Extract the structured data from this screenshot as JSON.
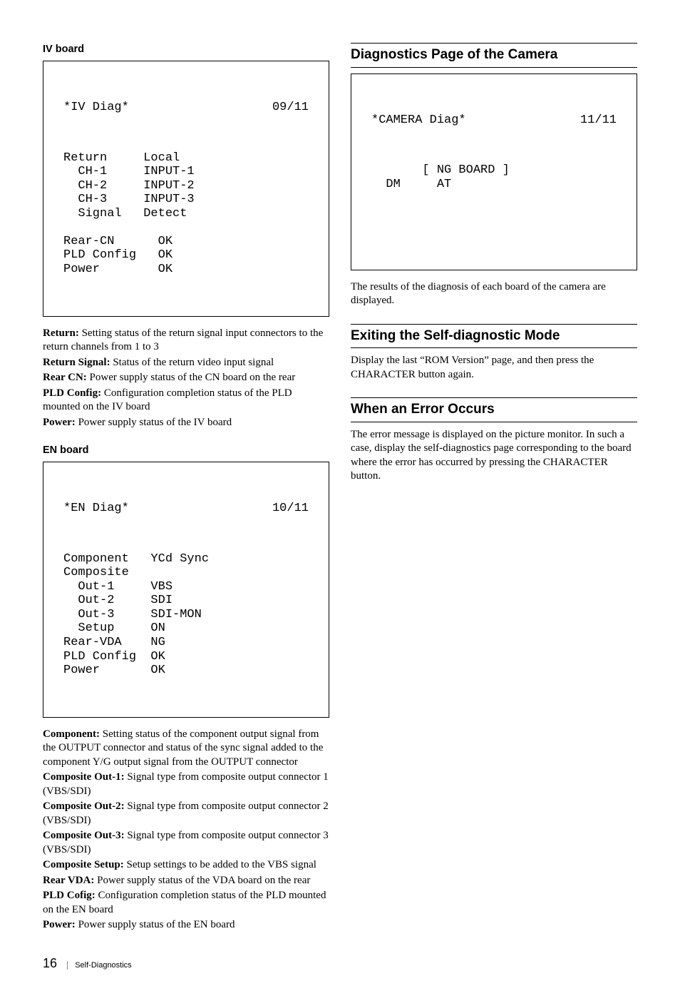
{
  "left": {
    "iv": {
      "heading": "IV board",
      "box": {
        "title": "*IV Diag*",
        "page": "09/11",
        "lines": [
          "Return     Local",
          "  CH-1     INPUT-1",
          "  CH-2     INPUT-2",
          "  CH-3     INPUT-3",
          "  Signal   Detect",
          "",
          "Rear-CN      OK",
          "PLD Config   OK",
          "Power        OK"
        ]
      },
      "defs": [
        {
          "t": "Return:",
          "d": " Setting status of the return signal input connectors to the return channels from 1 to 3"
        },
        {
          "t": "Return Signal:",
          "d": " Status of the return video input signal"
        },
        {
          "t": "Rear CN:",
          "d": " Power supply status of the CN board on the rear"
        },
        {
          "t": "PLD Config:",
          "d": " Configuration completion status of the PLD mounted on the IV board"
        },
        {
          "t": "Power:",
          "d": " Power supply status of the IV board"
        }
      ]
    },
    "en": {
      "heading": "EN board",
      "box": {
        "title": "*EN Diag*",
        "page": "10/11",
        "lines": [
          "Component   YCd Sync",
          "Composite",
          "  Out-1     VBS",
          "  Out-2     SDI",
          "  Out-3     SDI-MON",
          "  Setup     ON",
          "Rear-VDA    NG",
          "PLD Config  OK",
          "Power       OK"
        ]
      },
      "defs": [
        {
          "t": "Component:",
          "d": " Setting status of the component output signal from the OUTPUT connector and status of the sync signal added to the component Y/G output signal from the OUTPUT connector"
        },
        {
          "t": "Composite Out-1:",
          "d": " Signal type from composite output connector 1 (VBS/SDI)"
        },
        {
          "t": "Composite Out-2:",
          "d": " Signal type from composite output connector 2 (VBS/SDI)"
        },
        {
          "t": "Composite Out-3:",
          "d": " Signal type from composite output connector 3 (VBS/SDI)"
        },
        {
          "t": "Composite Setup:",
          "d": " Setup settings to be added to the VBS signal"
        },
        {
          "t": "Rear VDA:",
          "d": " Power supply status of the VDA board on the rear"
        },
        {
          "t": "PLD Cofig:",
          "d": " Configuration completion status of the PLD mounted on the EN board"
        },
        {
          "t": "Power:",
          "d": " Power supply status of the EN board"
        }
      ]
    }
  },
  "right": {
    "diag_h": "Diagnostics Page of the Camera",
    "diag_box": {
      "title": "*CAMERA Diag*",
      "page": "11/11",
      "lines": [
        "       [ NG BOARD ]",
        "  DM     AT"
      ]
    },
    "diag_p": "The results of the diagnosis of each board of the camera are displayed.",
    "exit_h": "Exiting the Self-diagnostic Mode",
    "exit_p": "Display the last “ROM Version” page, and then press the CHARACTER button again.",
    "err_h": "When an Error Occurs",
    "err_p": "The error message is displayed on the picture monitor. In such a case, display the self-diagnostics page corresponding to the board where the error has occurred by pressing the CHARACTER button."
  },
  "footer": {
    "num": "16",
    "section": "Self-Diagnostics"
  }
}
